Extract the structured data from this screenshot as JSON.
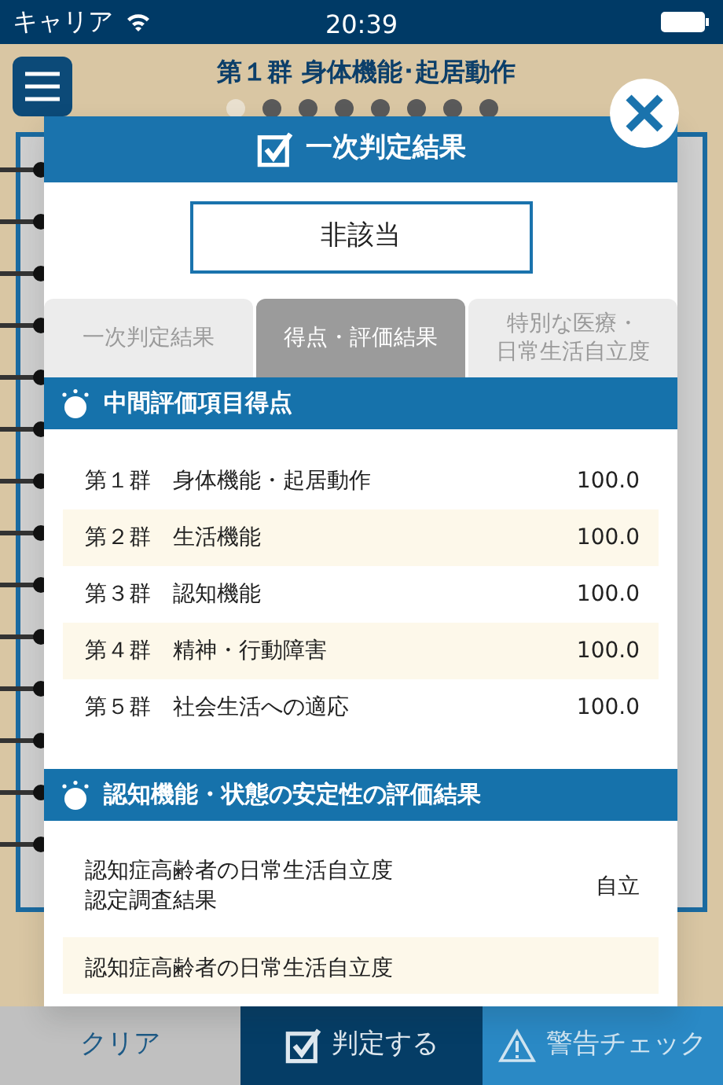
{
  "status_bar": {
    "carrier": "キャリア",
    "time": "20:39"
  },
  "header": {
    "title": "第１群 身体機能･起居動作"
  },
  "pager": [
    {
      "selected": true
    },
    {
      "selected": false
    },
    {
      "selected": false
    },
    {
      "selected": false
    },
    {
      "selected": false
    },
    {
      "selected": false
    },
    {
      "selected": false
    },
    {
      "selected": false
    }
  ],
  "dialog": {
    "title": "一次判定結果",
    "result": "非該当",
    "tabs": [
      {
        "label": "一次判定結果",
        "selected": false
      },
      {
        "label": "得点・評価結果",
        "selected": true
      },
      {
        "lines": [
          "特別な医療・",
          "日常生活自立度"
        ],
        "selected": false
      }
    ],
    "sections": [
      {
        "title": "中間評価項目得点",
        "rows": [
          {
            "label": "第１群　身体機能・起居動作",
            "value": "100.0"
          },
          {
            "label": "第２群　生活機能",
            "value": "100.0"
          },
          {
            "label": "第３群　認知機能",
            "value": "100.0"
          },
          {
            "label": "第４群　精神・行動障害",
            "value": "100.0"
          },
          {
            "label": "第５群　社会生活への適応",
            "value": "100.0"
          }
        ]
      },
      {
        "title": "認知機能・状態の安定性の評価結果",
        "rows": [
          {
            "lines": [
              "認知症高齢者の日常生活自立度",
              "認定調査結果"
            ],
            "value": "自立"
          },
          {
            "label": "認知症高齢者の日常生活自立度"
          }
        ]
      }
    ]
  },
  "footer": {
    "buttons": [
      {
        "label": "クリア",
        "kind": "clear"
      },
      {
        "label": "判定する",
        "kind": "judge"
      },
      {
        "label": "警告チェック",
        "kind": "warning"
      }
    ]
  }
}
